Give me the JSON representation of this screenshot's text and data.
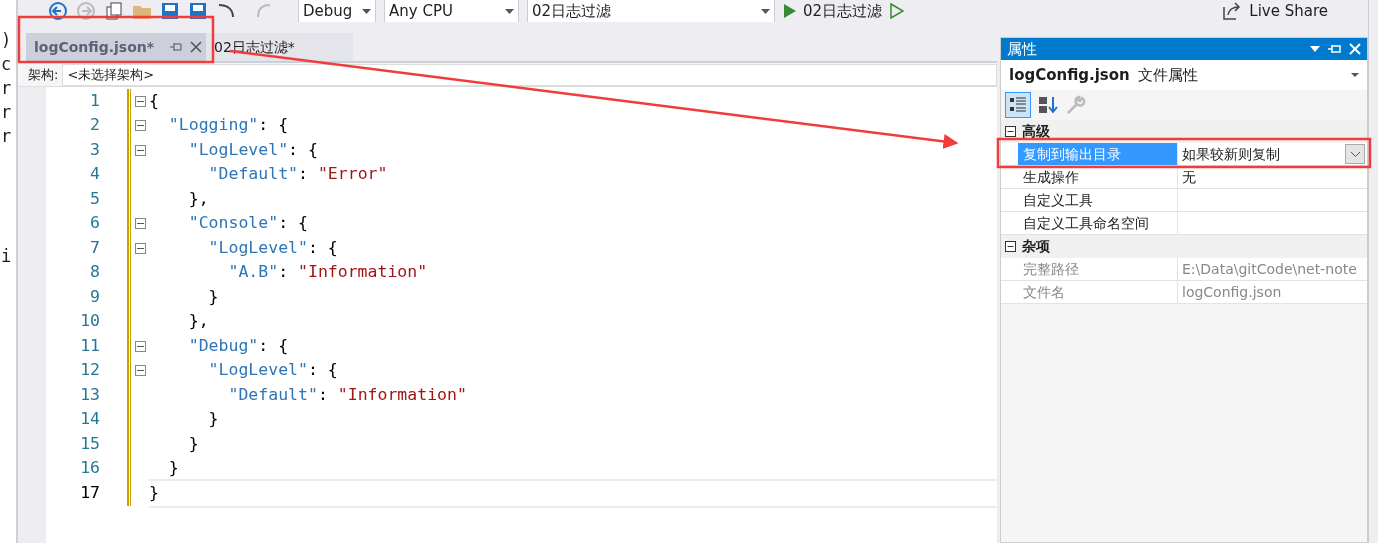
{
  "left_strip": {
    "fragments": [
      ")",
      "c",
      "r",
      "r",
      "r",
      "i"
    ]
  },
  "toolbar": {
    "combos": [
      {
        "value": "Debug"
      },
      {
        "value": "Any CPU"
      },
      {
        "value": "02日志过滤"
      }
    ],
    "run_label": "02日志过滤",
    "live_share": "Live Share"
  },
  "tabs": [
    {
      "label": "logConfig.json*",
      "selected": true
    },
    {
      "label": "02日志过滤*",
      "selected": false
    }
  ],
  "editor": {
    "architecture_label": "架构:",
    "architecture_value": "<未选择架构>",
    "lines": [
      {
        "number": "1",
        "foldable": true,
        "current": false,
        "tokens": [
          {
            "kind": "punct",
            "text": "{"
          }
        ]
      },
      {
        "number": "2",
        "foldable": true,
        "current": false,
        "tokens": [
          {
            "kind": "key",
            "text": "  \"Logging\""
          },
          {
            "kind": "punct",
            "text": ": {"
          }
        ]
      },
      {
        "number": "3",
        "foldable": true,
        "current": false,
        "tokens": [
          {
            "kind": "key",
            "text": "    \"LogLevel\""
          },
          {
            "kind": "punct",
            "text": ": {"
          }
        ]
      },
      {
        "number": "4",
        "foldable": false,
        "current": false,
        "tokens": [
          {
            "kind": "key",
            "text": "      \"Default\""
          },
          {
            "kind": "punct",
            "text": ": "
          },
          {
            "kind": "string",
            "text": "\"Error\""
          }
        ]
      },
      {
        "number": "5",
        "foldable": false,
        "current": false,
        "tokens": [
          {
            "kind": "punct",
            "text": "    },"
          }
        ]
      },
      {
        "number": "6",
        "foldable": true,
        "current": false,
        "tokens": [
          {
            "kind": "key",
            "text": "    \"Console\""
          },
          {
            "kind": "punct",
            "text": ": {"
          }
        ]
      },
      {
        "number": "7",
        "foldable": true,
        "current": false,
        "tokens": [
          {
            "kind": "key",
            "text": "      \"LogLevel\""
          },
          {
            "kind": "punct",
            "text": ": {"
          }
        ]
      },
      {
        "number": "8",
        "foldable": false,
        "current": false,
        "tokens": [
          {
            "kind": "key",
            "text": "        \"A.B\""
          },
          {
            "kind": "punct",
            "text": ": "
          },
          {
            "kind": "string",
            "text": "\"Information\""
          }
        ]
      },
      {
        "number": "9",
        "foldable": false,
        "current": false,
        "tokens": [
          {
            "kind": "punct",
            "text": "      }"
          }
        ]
      },
      {
        "number": "10",
        "foldable": false,
        "current": false,
        "tokens": [
          {
            "kind": "punct",
            "text": "    },"
          }
        ]
      },
      {
        "number": "11",
        "foldable": true,
        "current": false,
        "tokens": [
          {
            "kind": "key",
            "text": "    \"Debug\""
          },
          {
            "kind": "punct",
            "text": ": {"
          }
        ]
      },
      {
        "number": "12",
        "foldable": true,
        "current": false,
        "tokens": [
          {
            "kind": "key",
            "text": "      \"LogLevel\""
          },
          {
            "kind": "punct",
            "text": ": {"
          }
        ]
      },
      {
        "number": "13",
        "foldable": false,
        "current": false,
        "tokens": [
          {
            "kind": "key",
            "text": "        \"Default\""
          },
          {
            "kind": "punct",
            "text": ": "
          },
          {
            "kind": "string",
            "text": "\"Information\""
          }
        ]
      },
      {
        "number": "14",
        "foldable": false,
        "current": false,
        "tokens": [
          {
            "kind": "punct",
            "text": "      }"
          }
        ]
      },
      {
        "number": "15",
        "foldable": false,
        "current": false,
        "tokens": [
          {
            "kind": "punct",
            "text": "    }"
          }
        ]
      },
      {
        "number": "16",
        "foldable": false,
        "current": false,
        "tokens": [
          {
            "kind": "punct",
            "text": "  }"
          }
        ]
      },
      {
        "number": "17",
        "foldable": false,
        "current": true,
        "tokens": [
          {
            "kind": "punct",
            "text": "}"
          }
        ]
      }
    ]
  },
  "properties": {
    "title": "属性",
    "object_name": "logConfig.json",
    "object_type": "文件属性",
    "categories": [
      {
        "name": "高级",
        "expanded": true,
        "rows": [
          {
            "name": "复制到输出目录",
            "value": "如果较新则复制",
            "selected": true,
            "readonly": false
          },
          {
            "name": "生成操作",
            "value": "无",
            "selected": false,
            "readonly": false
          },
          {
            "name": "自定义工具",
            "selected": false,
            "readonly": false
          },
          {
            "name": "自定义工具命名空间",
            "selected": false,
            "readonly": false
          }
        ]
      },
      {
        "name": "杂项",
        "expanded": true,
        "rows": [
          {
            "name": "完整路径",
            "value": "E:\\Data\\gitCode\\net-note",
            "selected": false,
            "readonly": true
          },
          {
            "name": "文件名",
            "value": "logConfig.json",
            "selected": false,
            "readonly": true
          }
        ]
      }
    ]
  },
  "annotations": [
    {
      "kind": "box"
    },
    {
      "kind": "box"
    },
    {
      "kind": "arrow"
    }
  ]
}
